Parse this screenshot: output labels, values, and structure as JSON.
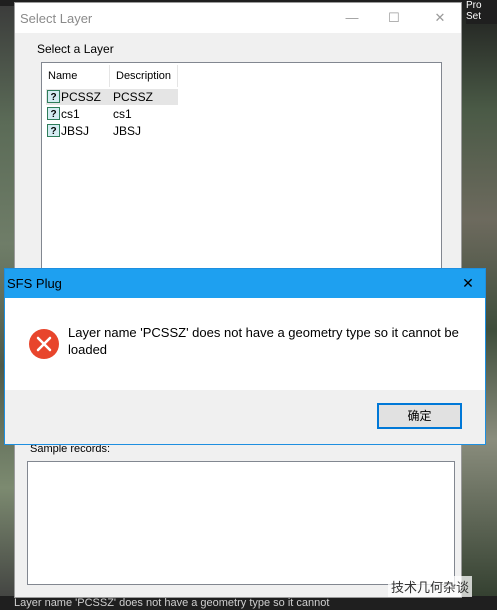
{
  "background": {
    "right_menu_lines": [
      "Pro",
      "Set"
    ],
    "bottom_text": "Layer name 'PCSSZ' does not have a geometry type so it cannot"
  },
  "select_layer_window": {
    "title": "Select Layer",
    "controls": {
      "minimize": "—",
      "maximize": "☐",
      "close": "✕"
    },
    "group_label": "Select a Layer",
    "columns": [
      "Name",
      "Description"
    ],
    "rows": [
      {
        "icon": "?",
        "name": "PCSSZ",
        "description": "PCSSZ",
        "selected": true
      },
      {
        "icon": "?",
        "name": "cs1",
        "description": "cs1",
        "selected": false
      },
      {
        "icon": "?",
        "name": "JBSJ",
        "description": "JBSJ",
        "selected": false
      }
    ],
    "sample_label": "Sample records:"
  },
  "error_dialog": {
    "title": "SFS Plug",
    "close_glyph": "✕",
    "message": "Layer name 'PCSSZ' does not have a geometry type so it cannot be loaded",
    "ok_label": "确定",
    "colors": {
      "titlebar": "#1ea0f0",
      "error_icon": "#e8452c",
      "button_border": "#0078d7"
    }
  },
  "watermark": {
    "text": "技术几何杂谈"
  }
}
